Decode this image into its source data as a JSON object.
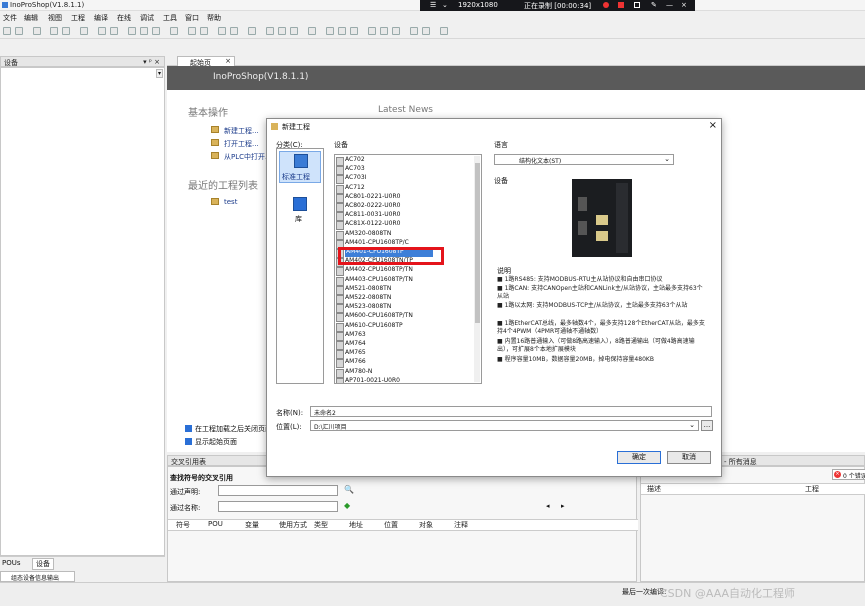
{
  "app": {
    "title": "InoProShop(V1.8.1.1)"
  },
  "recorder": {
    "resolution": "1920x1080",
    "status": "正在录制 [00:00:34]"
  },
  "menu": [
    "文件",
    "编辑",
    "视图",
    "工程",
    "编译",
    "在线",
    "调试",
    "工具",
    "窗口",
    "帮助"
  ],
  "device_panel": {
    "title": "设备",
    "pin": "▾ ᵖ ×"
  },
  "start_tab": {
    "label": "起始页",
    "close": "×"
  },
  "start_page": {
    "banner": "InoProShop(V1.8.1.1)",
    "basic_ops": "基本操作",
    "links": [
      "新建工程...",
      "打开工程...",
      "从PLC中打开..."
    ],
    "recent": "最近的工程列表",
    "recent_items": [
      "test"
    ],
    "news": "Latest News",
    "check1": "在工程加载之后关闭页面",
    "check2": "显示起始页面"
  },
  "dialog": {
    "title": "新建工程",
    "close": "×",
    "category_label": "分类(C):",
    "categories": [
      "标准工程",
      "库"
    ],
    "device_label": "设备",
    "devices": [
      "AC702",
      "AC703",
      "AC703I",
      "AC712",
      "AC801-0221-U0R0",
      "AC802-0222-U0R0",
      "AC811-0031-U0R0",
      "AC81X-0122-U0R0",
      "AM320-0808TN",
      "AM401-CPU1608TP/C",
      "AM401-CPU1608TP",
      "AM402-CPU1608TN/TP",
      "AM402-CPU1608TP/TN",
      "AM403-CPU1608TP/TN",
      "AM521-0808TN",
      "AM522-0808TN",
      "AM523-0808TN",
      "AM600-CPU1608TP/TN",
      "AM610-CPU1608TP",
      "AM763",
      "AM764",
      "AM765",
      "AM766",
      "AM780-N",
      "AP701-0021-U0R0"
    ],
    "selected_index": 10,
    "language_label": "语言",
    "language_value": "结构化文本(ST)",
    "device_img_label": "设备",
    "desc_title": "说明",
    "desc_lines": [
      "■ 1路RS485: 支持MODBUS-RTU主从站协议和自由串口协议",
      "■ 1路CAN: 支持CANOpen主站和CANLink主/从站协议，主站最多支持63个从站",
      "■ 1路以太网: 支持MODBUS-TCP主/从站协议，主站最多支持63个从站",
      "■ 1路EtherCAT总线，最多轴数4个，最多支持128个EtherCAT从站，最多支持4个4PWM（4PMR可通轴不通轴数）",
      "■ 内置16路普通输入（可做8路高速输入），8路普通输出（可做4路高速输出），可扩展8个本地扩展模块",
      "■ 程序容量10MB，数据容量20MB，掉电保持容量480KB"
    ],
    "name_label": "名称(N):",
    "name_value": "未命名2",
    "location_label": "位置(L):",
    "location_value": "D:\\汇川项目",
    "browse": "...",
    "ok": "确定",
    "cancel": "取消"
  },
  "crossref": {
    "title": "交叉引用表",
    "find_label": "查找符号的交叉引用",
    "via_decl": "通过声明:",
    "via_name": "通过名称:",
    "columns": [
      "符号",
      "POU",
      "变量",
      "使用方式",
      "类型",
      "地址",
      "位置",
      "对象",
      "注释"
    ]
  },
  "messages": {
    "title": "- 所有消息",
    "count": "0 个错误",
    "columns": [
      "描述",
      "工程"
    ]
  },
  "bottom_tabs": [
    "POUs",
    "设备"
  ],
  "output_tab": "组态设备信息输出",
  "status": {
    "left": "最后一次编译:",
    "watermark": "CSDN @AAA自动化工程师"
  },
  "colors": {
    "accent": "#2a6fd6",
    "highlight": "#e4141b",
    "banner": "#5a5a5a"
  }
}
